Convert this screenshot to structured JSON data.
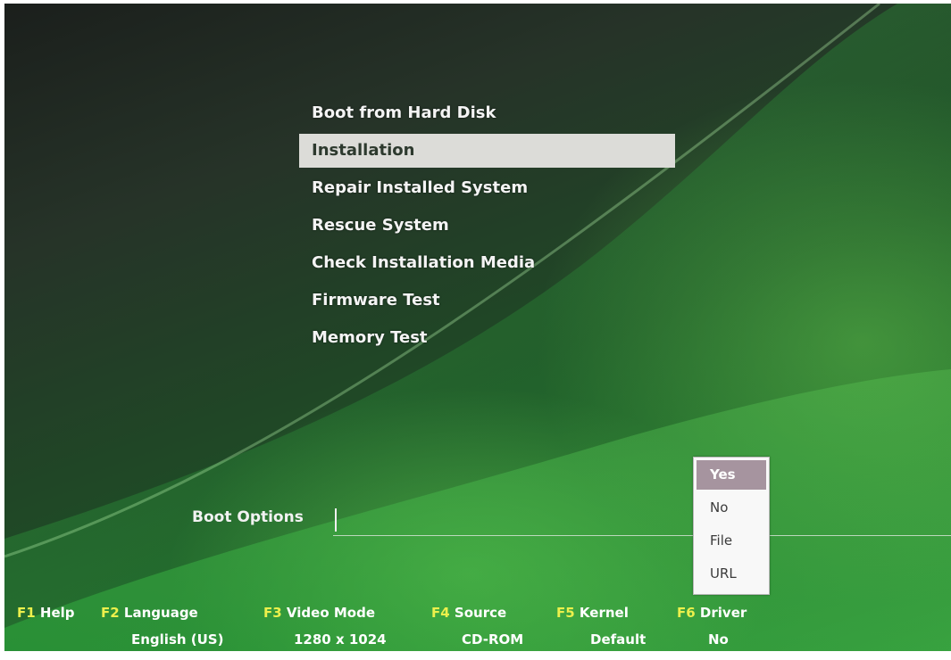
{
  "menu": {
    "items": [
      {
        "label": "Boot from Hard Disk"
      },
      {
        "label": "Installation"
      },
      {
        "label": "Repair Installed System"
      },
      {
        "label": "Rescue System"
      },
      {
        "label": "Check Installation Media"
      },
      {
        "label": "Firmware Test"
      },
      {
        "label": "Memory Test"
      }
    ],
    "selected_index": 1
  },
  "boot_options": {
    "label": "Boot Options",
    "value": ""
  },
  "driver_dropdown": {
    "options": [
      "Yes",
      "No",
      "File",
      "URL"
    ],
    "selected": "Yes"
  },
  "function_keys": [
    {
      "key": "F1",
      "name": "Help",
      "value": ""
    },
    {
      "key": "F2",
      "name": "Language",
      "value": "English (US)"
    },
    {
      "key": "F3",
      "name": "Video Mode",
      "value": "1280 x 1024"
    },
    {
      "key": "F4",
      "name": "Source",
      "value": "CD-ROM"
    },
    {
      "key": "F5",
      "name": "Kernel",
      "value": "Default"
    },
    {
      "key": "F6",
      "name": "Driver",
      "value": "No"
    }
  ],
  "colors": {
    "key_label": "#ecf04c",
    "text": "#ffffff",
    "selection_bar": "#dcdcd8",
    "dropdown_highlight": "#a6949f"
  }
}
